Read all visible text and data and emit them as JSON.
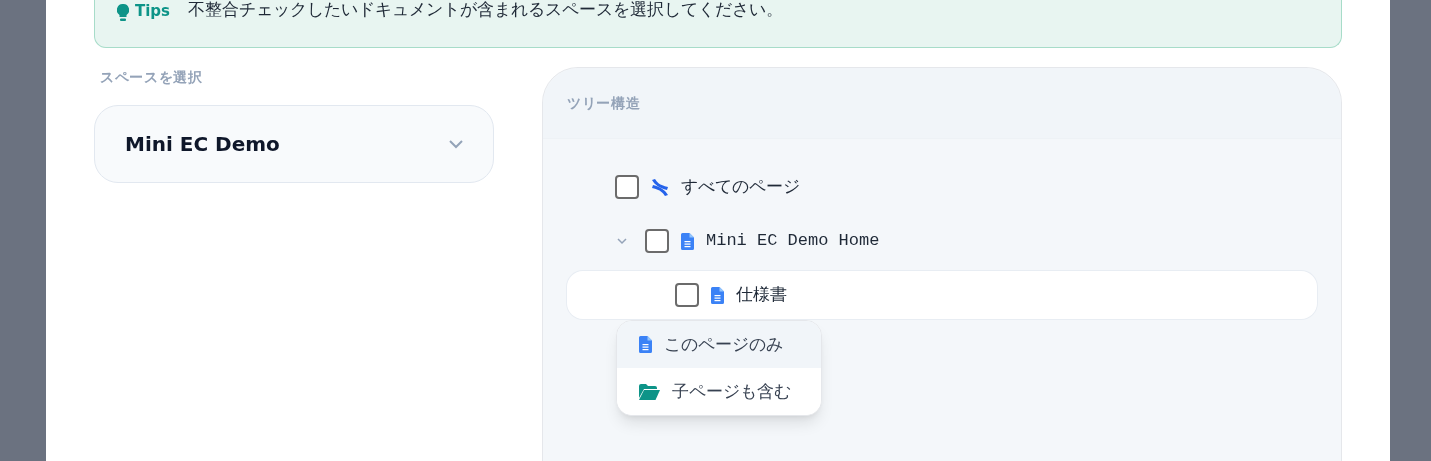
{
  "tips": {
    "label": "Tips",
    "text": "不整合チェックしたいドキュメントが含まれるスペースを選択してください。"
  },
  "space_select": {
    "label": "スペースを選択",
    "value": "Mini EC Demo"
  },
  "tree": {
    "title": "ツリー構造",
    "items": [
      {
        "kind": "all",
        "label": "すべてのページ",
        "checked": false,
        "selected": false
      },
      {
        "kind": "page",
        "label": "Mini EC Demo Home",
        "checked": false,
        "selected": false,
        "expanded": true,
        "children": [
          {
            "kind": "page",
            "label": "仕様書",
            "checked": false,
            "selected": true
          }
        ]
      }
    ]
  },
  "menu": {
    "items": [
      {
        "kind": "page",
        "label": "このページのみ",
        "selected": true
      },
      {
        "kind": "folder",
        "label": "子ページも含む",
        "selected": false
      }
    ]
  }
}
